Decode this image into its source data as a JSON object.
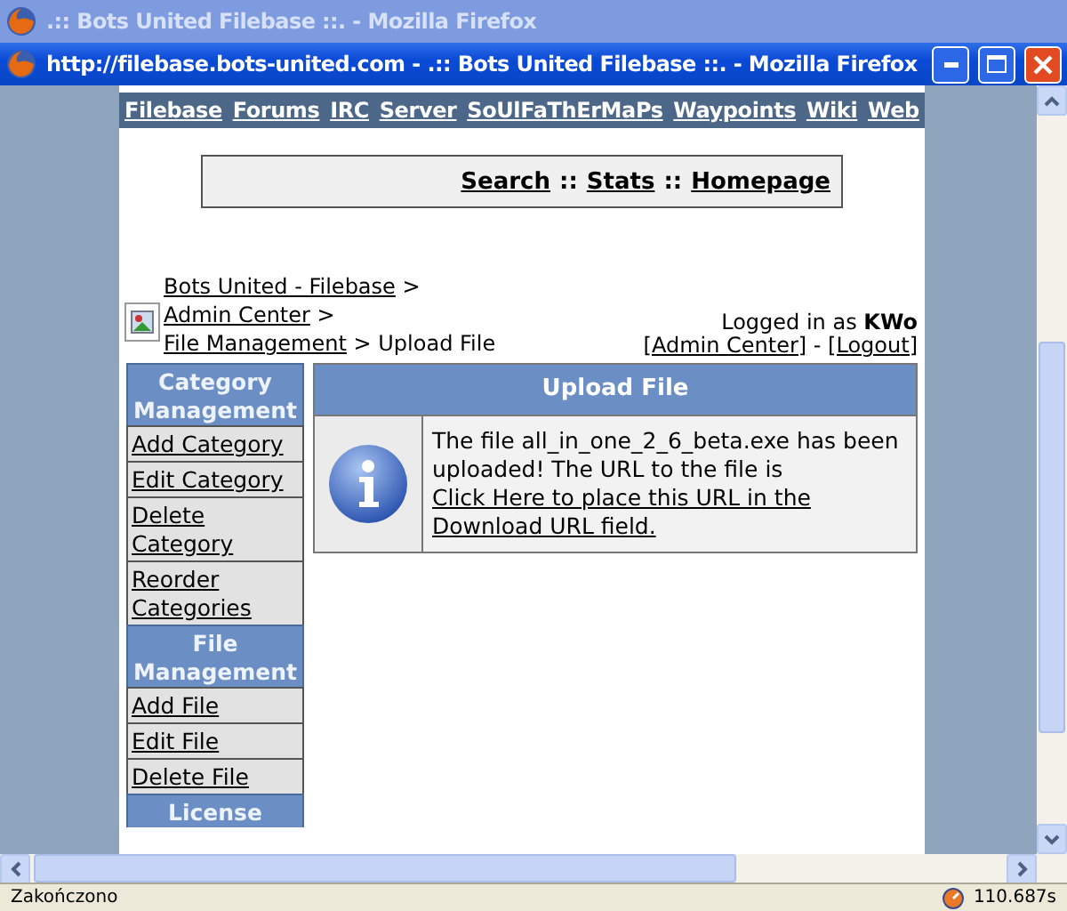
{
  "background_window": {
    "title": ".:: Bots United Filebase ::. - Mozilla Firefox"
  },
  "window": {
    "title": "http://filebase.bots-united.com - .:: Bots United Filebase ::. - Mozilla Firefox"
  },
  "nav_links": [
    "Filebase",
    "Forums",
    "IRC",
    "Server",
    "SoUlFaThErMaPs",
    "Waypoints",
    "Wiki",
    "Web"
  ],
  "top_links": [
    "Search",
    "::",
    "Stats",
    "::",
    "Homepage"
  ],
  "breadcrumb": {
    "links": [
      "Bots United - Filebase",
      "Admin Center",
      "File Management"
    ],
    "separator": ">",
    "current": "Upload File"
  },
  "login": {
    "text": "Logged in as",
    "user": "KWo",
    "links": [
      "[Admin Center]",
      "[Logout]"
    ],
    "separator": "-"
  },
  "sidebar": [
    {
      "kind": "header",
      "label": "Category Management"
    },
    {
      "kind": "link",
      "label": "Add Category"
    },
    {
      "kind": "link",
      "label": "Edit Category"
    },
    {
      "kind": "link",
      "label": "Delete Category"
    },
    {
      "kind": "link",
      "label": "Reorder Categories"
    },
    {
      "kind": "header",
      "label": "File Management"
    },
    {
      "kind": "link",
      "label": "Add File"
    },
    {
      "kind": "link",
      "label": "Edit File"
    },
    {
      "kind": "link",
      "label": "Delete File"
    },
    {
      "kind": "header",
      "label": "License"
    }
  ],
  "panel": {
    "title": "Upload File",
    "message": "The file all_in_one_2_6_beta.exe has been uploaded! The URL to the file is",
    "link": "Click Here to place this URL in the Download URL field."
  },
  "status_bar": {
    "text": "Zakończono",
    "timer": "110.687s"
  }
}
